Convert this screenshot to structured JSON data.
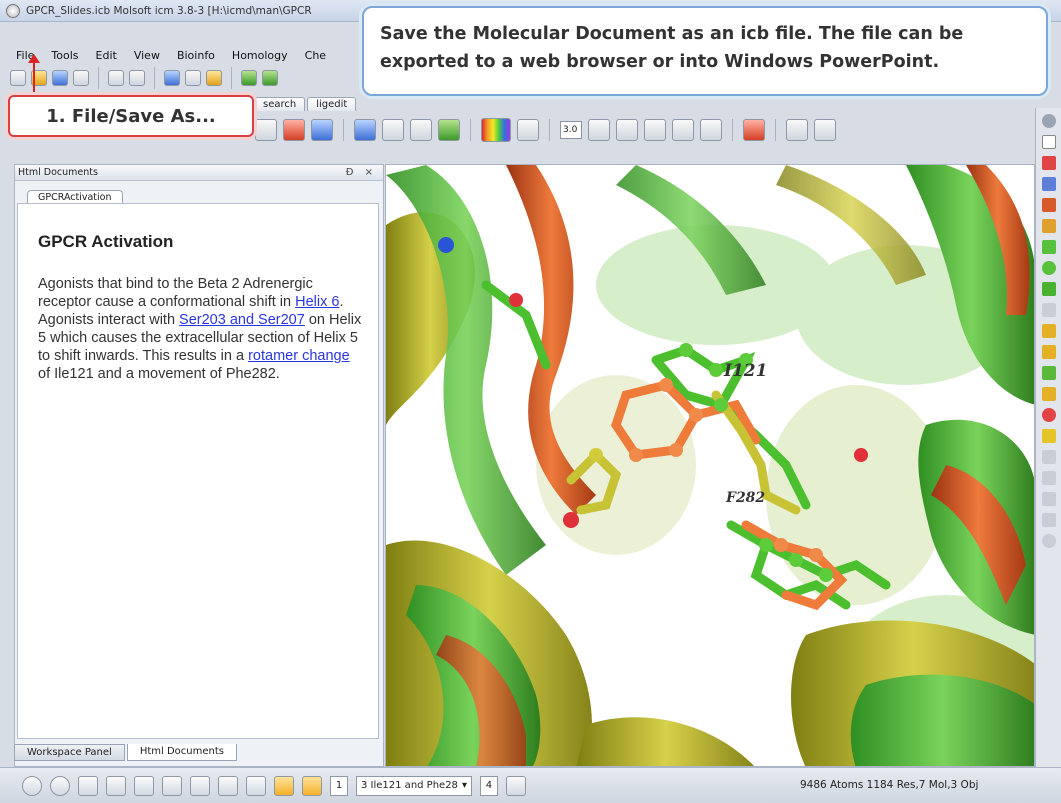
{
  "window": {
    "title": "GPCR_Slides.icb Molsoft icm 3.8-3  [H:\\icmd\\man\\GPCR"
  },
  "menubar": {
    "items": [
      "File",
      "Tools",
      "Edit",
      "View",
      "Bioinfo",
      "Homology",
      "Che"
    ]
  },
  "toolbar_tabs": [
    "search",
    "ligedit"
  ],
  "toolbar": {
    "clip_value": "3.0"
  },
  "left_panel": {
    "title": "Html Documents",
    "controls": "Ɖ ×",
    "doc_tab": "GPCRActivation",
    "heading": "GPCR Activation",
    "paragraph": {
      "t1": "Agonists that bind to the Beta 2 Adrenergic receptor cause a conformational shift in ",
      "link1": "Helix 6",
      "t2": ". Agonists interact with ",
      "link2": "Ser203 and Ser207",
      "t3": " on Helix 5 which causes the extracellular section of Helix 5 to shift inwards.  This results in a ",
      "link3": "rotamer change",
      "t4": " of Ile121 and a movement of Phe282."
    },
    "bottom_tabs": [
      "Workspace Panel",
      "Html Documents"
    ]
  },
  "viewport": {
    "labels": [
      "I121",
      "F282"
    ]
  },
  "statusbar": {
    "page_current": "1",
    "selection": "3 Ile121 and Phe28",
    "page_total": "4",
    "info": "9486 Atoms 1184 Res,7 Mol,3 Obj"
  },
  "callouts": {
    "main_line1": "Save the Molecular Document as an icb file. The file can be",
    "main_line2": "exported to a web browser or into Windows PowerPoint.",
    "file_step": "1. File/Save As..."
  },
  "colors": {
    "ribbon_green": "#4fb53c",
    "ribbon_orange": "#d65a1f",
    "ribbon_olive": "#b3b32a",
    "link_blue": "#2a36e0",
    "callout_blue": "#7aa6d8",
    "callout_red": "#d64040"
  }
}
